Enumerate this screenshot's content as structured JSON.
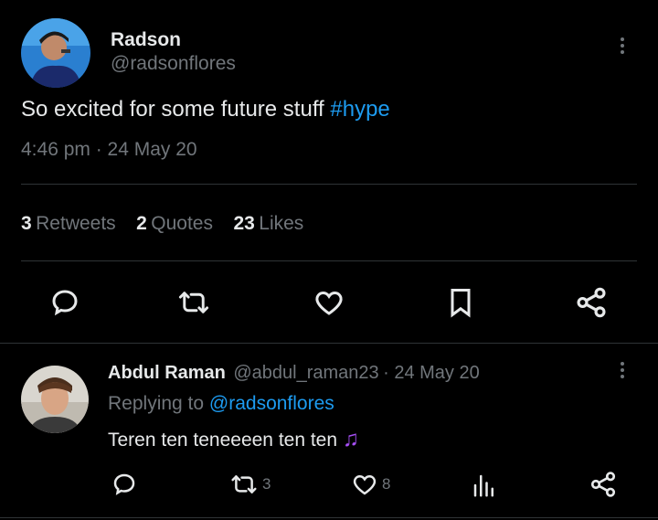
{
  "tweet": {
    "author_name": "Radson",
    "author_handle": "@radsonflores",
    "text_main": "So excited for some future stuff ",
    "hashtag": "#hype",
    "timestamp": "4:46 pm · 24 May 20",
    "stats": {
      "retweets_count": "3",
      "retweets_label": "Retweets",
      "quotes_count": "2",
      "quotes_label": "Quotes",
      "likes_count": "23",
      "likes_label": "Likes"
    },
    "actions": [
      "reply-icon",
      "retweet-icon",
      "like-icon",
      "bookmark-icon",
      "share-icon"
    ]
  },
  "reply": {
    "author_name": "Abdul Raman",
    "author_handle": "@abdul_raman23",
    "date": "· 24 May 20",
    "replying_prefix": "Replying to ",
    "replying_handle": "@radsonflores",
    "text": "Teren ten teneeeen ten ten",
    "emoji": "♫",
    "retweet_count": "3",
    "like_count": "8",
    "actions": [
      "reply-icon",
      "retweet-icon",
      "like-icon",
      "views-icon",
      "share-icon"
    ]
  },
  "colors": {
    "background": "#000000",
    "text": "#e7e9ea",
    "muted": "#71767b",
    "accent": "#1d9bf0",
    "divider": "#2f3336",
    "emoji": "#a64ff5"
  }
}
